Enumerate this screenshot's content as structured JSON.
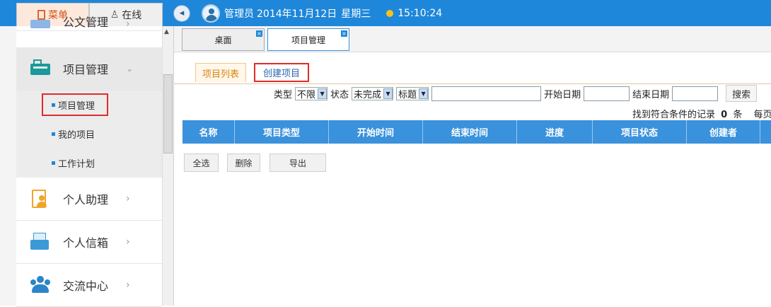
{
  "left_tabs": {
    "menu": "菜单",
    "online": "在线"
  },
  "topinfo": {
    "user": "管理员",
    "date": "2014年11月12日",
    "weekday": "星期三",
    "time": "15:10:24"
  },
  "sidebar": {
    "partial_item": "公文管理",
    "items": [
      {
        "label": "项目管理",
        "icon": "briefcase-icon"
      },
      {
        "label": "个人助理",
        "icon": "person-card-icon"
      },
      {
        "label": "个人信箱",
        "icon": "mailbox-icon"
      },
      {
        "label": "交流中心",
        "icon": "group-icon"
      }
    ],
    "subitems": [
      "项目管理",
      "我的项目",
      "工作计划"
    ]
  },
  "tabs": [
    {
      "label": "桌面"
    },
    {
      "label": "项目管理"
    }
  ],
  "subtabs": {
    "list": "项目列表",
    "create": "创建项目"
  },
  "filter": {
    "type_label": "类型",
    "type_value": "不限",
    "status_label": "状态",
    "status_value": "未完成",
    "field_value": "标题",
    "start_label": "开始日期",
    "end_label": "结束日期",
    "search_label": "搜索"
  },
  "count": {
    "prefix": "找到符合条件的记录",
    "value": "0",
    "suffix": "条",
    "per_page": "每页"
  },
  "table": {
    "columns": [
      "名称",
      "项目类型",
      "开始时间",
      "结束时间",
      "进度",
      "项目状态",
      "创建者"
    ]
  },
  "actions": {
    "select_all": "全选",
    "delete": "删除",
    "export": "导出"
  },
  "colors": {
    "accent": "#1f87d9",
    "header": "#3a91dc",
    "highlight": "#e02b2b"
  }
}
